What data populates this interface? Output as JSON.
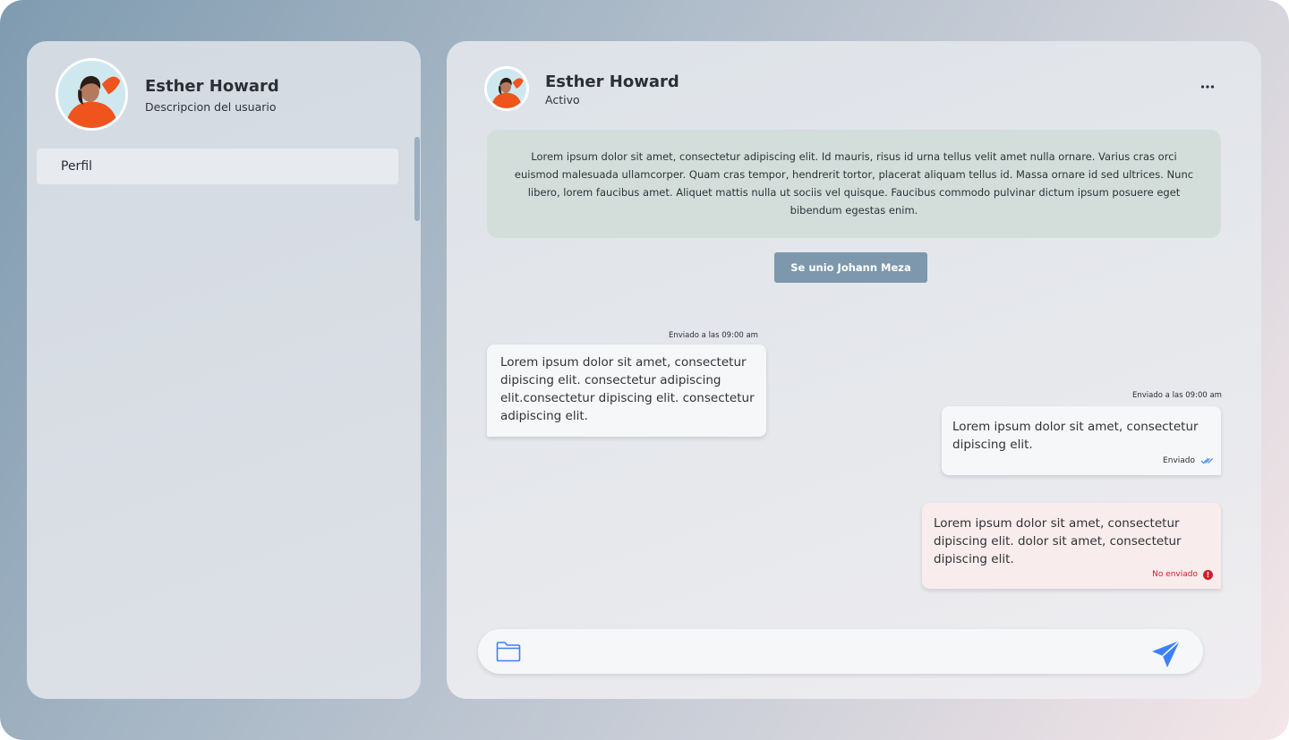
{
  "sidebar": {
    "user_name": "Esther Howard",
    "user_description": "Descripcion del usuario",
    "menu_items": [
      {
        "label": "Perfil"
      }
    ]
  },
  "chat": {
    "header": {
      "name": "Esther Howard",
      "status": "Activo",
      "more_icon": "more-horizontal-icon"
    },
    "info_text": "Lorem ipsum dolor sit amet, consectetur adipiscing elit. Id mauris, risus id urna tellus velit amet nulla ornare. Varius cras orci euismod malesuada ullamcorper. Quam cras tempor, hendrerit tortor, placerat aliquam tellus id. Massa ornare id sed ultrices. Nunc libero, lorem faucibus amet. Aliquet mattis nulla ut sociis vel quisque. Faucibus commodo pulvinar dictum ipsum posuere eget bibendum egestas enim.",
    "join_notice": "Se unio Johann Meza",
    "messages": [
      {
        "direction": "incoming",
        "timestamp": "Enviado a las 09:00 am",
        "text": "Lorem ipsum dolor sit amet, consectetur dipiscing elit. consectetur adipiscing elit.consectetur dipiscing elit. consectetur adipiscing elit."
      },
      {
        "direction": "outgoing",
        "timestamp": "Enviado a las 09:00 am",
        "text": "Lorem ipsum dolor sit amet, consectetur dipiscing elit.",
        "status": "Enviado",
        "status_icon": "double-check-icon"
      },
      {
        "direction": "outgoing",
        "text": "Lorem ipsum dolor sit amet, consectetur dipiscing elit. dolor sit amet, consectetur dipiscing elit.",
        "status": "No enviado",
        "status_icon": "error-icon"
      }
    ],
    "composer": {
      "placeholder": "",
      "attach_icon": "folder-icon",
      "send_icon": "send-icon"
    }
  },
  "colors": {
    "accent": "#3b82f6",
    "info_box": "#d3ddda",
    "join_pill": "#7d98ad",
    "error": "#d11d2e",
    "error_bubble": "#f9ecec"
  }
}
